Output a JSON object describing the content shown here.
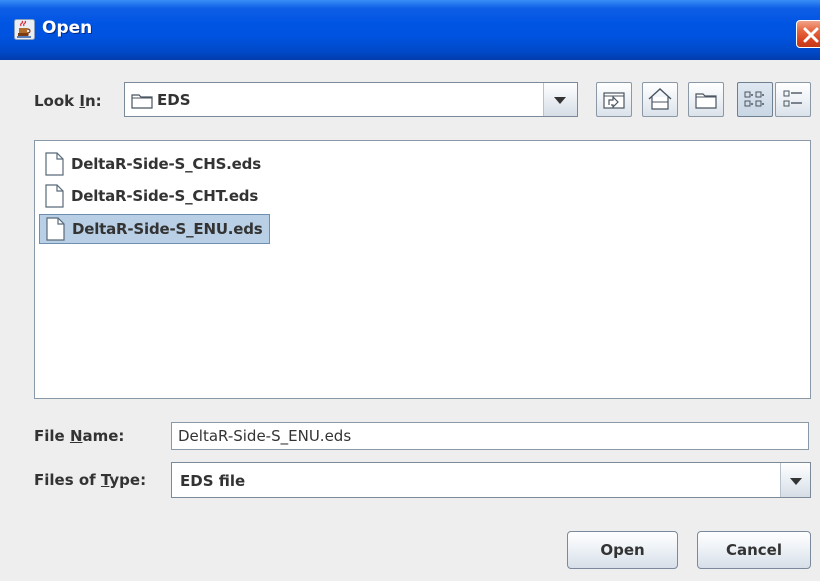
{
  "window": {
    "title": "Open"
  },
  "look_in": {
    "label": "Look In:",
    "value": "EDS"
  },
  "toolbar": {
    "up_one_level": "up-one-level-icon",
    "home": "home-icon",
    "new_folder": "new-folder-icon",
    "list_view": "list-view-icon",
    "details_view": "details-view-icon"
  },
  "files": [
    {
      "name": "DeltaR-Side-S_CHS.eds",
      "selected": false
    },
    {
      "name": "DeltaR-Side-S_CHT.eds",
      "selected": false
    },
    {
      "name": "DeltaR-Side-S_ENU.eds",
      "selected": true
    }
  ],
  "file_name": {
    "label": "File Name:",
    "value": "DeltaR-Side-S_ENU.eds"
  },
  "file_type": {
    "label": "Files of Type:",
    "value": "EDS file"
  },
  "buttons": {
    "open": "Open",
    "cancel": "Cancel"
  },
  "colors": {
    "titlebar": "#0054e3",
    "selection": "#b8cfe5",
    "close": "#d8421f"
  }
}
